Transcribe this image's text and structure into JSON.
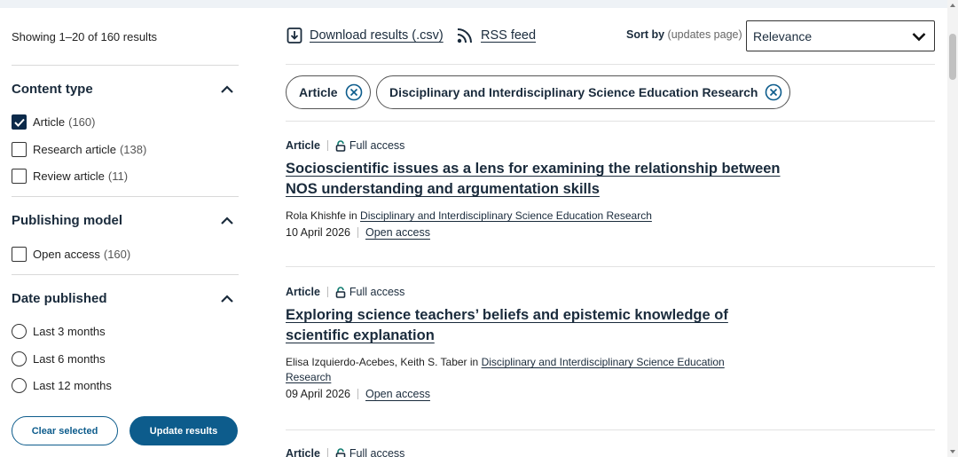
{
  "sidebar": {
    "showing": "Showing 1–20 of 160 results",
    "facets": [
      {
        "title": "Content type",
        "options": [
          {
            "label": "Article",
            "count": "(160)",
            "checked": true
          },
          {
            "label": "Research article",
            "count": "(138)",
            "checked": false
          },
          {
            "label": "Review article",
            "count": "(11)",
            "checked": false
          }
        ]
      },
      {
        "title": "Publishing model",
        "options": [
          {
            "label": "Open access",
            "count": "(160)",
            "checked": false
          }
        ]
      },
      {
        "title": "Date published",
        "options": [
          {
            "label": "Last 3 months"
          },
          {
            "label": "Last 6 months"
          },
          {
            "label": "Last 12 months"
          }
        ]
      }
    ],
    "clear_label": "Clear selected",
    "update_label": "Update results"
  },
  "toolbar": {
    "download_label": "Download results (.csv)",
    "rss_label": "RSS feed",
    "sort_label": "Sort by",
    "sort_hint": "(updates page)",
    "sort_value": "Relevance"
  },
  "chips": [
    {
      "label": "Article"
    },
    {
      "label": "Disciplinary and Interdisciplinary Science Education Research"
    }
  ],
  "results": [
    {
      "type": "Article",
      "access": "Full access",
      "title": "Socioscientific issues as a lens for examining the relationship between NOS understanding and argumentation skills",
      "authors": "Rola Khishfe in ",
      "journal": "Disciplinary and Interdisciplinary Science Education Research",
      "date": "10 April 2026",
      "oa": "Open access"
    },
    {
      "type": "Article",
      "access": "Full access",
      "title": "Exploring science teachers’ beliefs and epistemic knowledge of scientific explanation",
      "authors": "Elisa Izquierdo-Acebes, Keith S. Taber in ",
      "journal": "Disciplinary and Interdisciplinary Science Education Research",
      "date": "09 April 2026",
      "oa": "Open access"
    },
    {
      "type": "Article",
      "access": "Full access"
    }
  ],
  "colors": {
    "accent": "#0d5c8c",
    "navy": "#0b2a4a",
    "text": "#1a2b3c"
  }
}
